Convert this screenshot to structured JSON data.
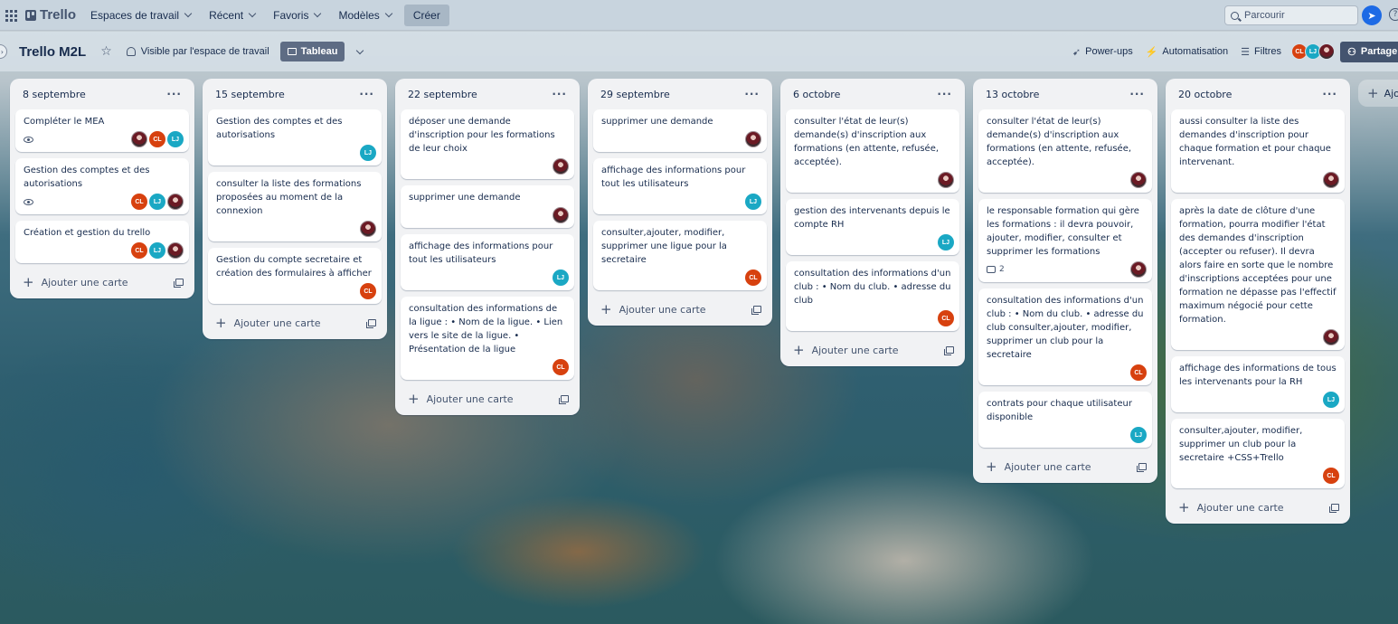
{
  "topbar": {
    "logo": "Trello",
    "nav": [
      "Espaces de travail",
      "Récent",
      "Favoris",
      "Modèles"
    ],
    "create": "Créer",
    "search_placeholder": "Parcourir"
  },
  "board": {
    "title": "Trello M2L",
    "visibility": "Visible par l'espace de travail",
    "view": "Tableau",
    "tools": [
      "Power-ups",
      "Automatisation",
      "Filtres"
    ],
    "members": [
      "CL",
      "LJ",
      ""
    ],
    "share": "Partager"
  },
  "add_card_label": "Ajouter une carte",
  "add_list_label": "Ajouter une liste",
  "lists": [
    {
      "title": "8 septembre",
      "cards": [
        {
          "text": "Compléter le MEA",
          "badges": {
            "watch": true
          },
          "avatars": [
            "photo",
            "CL",
            "LJ"
          ]
        },
        {
          "text": "Gestion des comptes et des autorisations",
          "badges": {
            "watch": true
          },
          "avatars": [
            "CL",
            "LJ",
            "photo"
          ]
        },
        {
          "text": "Création et gestion du trello",
          "badges": {},
          "avatars": [
            "CL",
            "LJ",
            "photo"
          ]
        }
      ]
    },
    {
      "title": "15 septembre",
      "cards": [
        {
          "text": "Gestion des comptes et des autorisations",
          "badges": {},
          "avatars": [
            "LJ"
          ]
        },
        {
          "text": "consulter la liste des formations proposées au moment de la connexion",
          "badges": {},
          "avatars": [
            "photo"
          ]
        },
        {
          "text": "Gestion du compte secretaire et création des formulaires à afficher",
          "badges": {},
          "avatars": [
            "CL"
          ]
        }
      ]
    },
    {
      "title": "22 septembre",
      "cards": [
        {
          "text": "déposer une demande d'inscription pour les formations de leur choix",
          "badges": {},
          "avatars": [
            "photo"
          ]
        },
        {
          "text": "supprimer une demande",
          "badges": {},
          "avatars": [
            "photo"
          ]
        },
        {
          "text": "affichage des informations pour tout les utilisateurs",
          "badges": {},
          "avatars": [
            "LJ"
          ]
        },
        {
          "text": "consultation des informations de la ligue : • Nom de la ligue. • Lien vers le site de la ligue. • Présentation de la ligue",
          "badges": {},
          "avatars": [
            "CL"
          ]
        }
      ]
    },
    {
      "title": "29 septembre",
      "cards": [
        {
          "text": "supprimer une demande",
          "badges": {},
          "avatars": [
            "photo"
          ]
        },
        {
          "text": "affichage des informations pour tout les utilisateurs",
          "badges": {},
          "avatars": [
            "LJ"
          ]
        },
        {
          "text": "consulter,ajouter, modifier, supprimer une ligue pour la secretaire",
          "badges": {},
          "avatars": [
            "CL"
          ]
        }
      ]
    },
    {
      "title": "6 octobre",
      "cards": [
        {
          "text": "consulter l'état de leur(s) demande(s) d'inscription aux formations (en attente, refusée, acceptée).",
          "badges": {},
          "avatars": [
            "photo"
          ]
        },
        {
          "text": "gestion des intervenants depuis le compte RH",
          "badges": {},
          "avatars": [
            "LJ"
          ]
        },
        {
          "text": "consultation des informations d'un club : • Nom du club. • adresse du club",
          "badges": {},
          "avatars": [
            "CL"
          ]
        }
      ]
    },
    {
      "title": "13 octobre",
      "cards": [
        {
          "text": "consulter l'état de leur(s) demande(s) d'inscription aux formations (en attente, refusée, acceptée).",
          "badges": {},
          "avatars": [
            "photo"
          ]
        },
        {
          "text": "le responsable formation qui gère les formations : il devra pouvoir, ajouter, modifier, consulter et supprimer les formations",
          "badges": {
            "comments": "2"
          },
          "avatars": [
            "photo"
          ]
        },
        {
          "text": "consultation des informations d'un club : • Nom du club. • adresse du club consulter,ajouter, modifier, supprimer un club pour la secretaire",
          "badges": {},
          "avatars": [
            "CL"
          ]
        },
        {
          "text": "contrats pour chaque utilisateur disponible",
          "badges": {},
          "avatars": [
            "LJ"
          ]
        }
      ]
    },
    {
      "title": "20 octobre",
      "cards": [
        {
          "text": "aussi consulter la liste des demandes d'inscription pour chaque formation et pour chaque intervenant.",
          "badges": {},
          "avatars": [
            "photo"
          ]
        },
        {
          "text": "après la date de clôture d'une formation, pourra modifier l'état des demandes d'inscription (accepter ou refuser). Il devra alors faire en sorte que le nombre d'inscriptions acceptées pour une formation ne dépasse pas l'effectif maximum négocié pour cette formation.",
          "badges": {},
          "avatars": [
            "photo"
          ]
        },
        {
          "text": "affichage des informations de tous les intervenants pour la RH",
          "badges": {},
          "avatars": [
            "LJ"
          ]
        },
        {
          "text": "consulter,ajouter, modifier, supprimer un club pour la secretaire +CSS+Trello",
          "badges": {},
          "avatars": [
            "CL"
          ]
        }
      ]
    }
  ]
}
